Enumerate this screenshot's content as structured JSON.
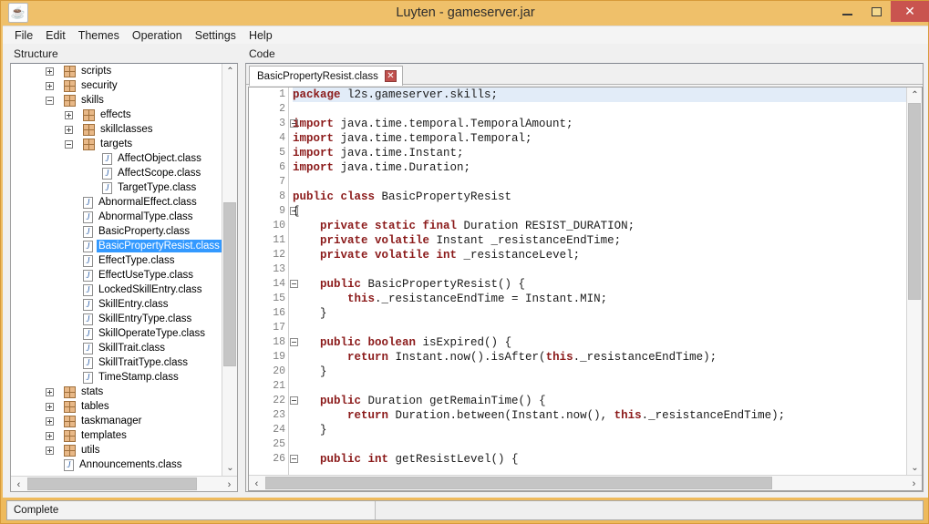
{
  "window": {
    "title": "Luyten - gameserver.jar",
    "app_icon": "coffee-cup-icon",
    "minimize_label": "–",
    "maximize_label": "☐",
    "close_label": "✕",
    "close_color": "#c9544f",
    "titlebar_color": "#efc06a"
  },
  "menubar": {
    "items": [
      {
        "label": "File"
      },
      {
        "label": "Edit"
      },
      {
        "label": "Themes"
      },
      {
        "label": "Operation"
      },
      {
        "label": "Settings"
      },
      {
        "label": "Help"
      }
    ]
  },
  "left_panel": {
    "label": "Structure",
    "tree": [
      {
        "label": "scripts",
        "indent": 1,
        "twisty": "plus",
        "icon": "package-icon",
        "selected": false
      },
      {
        "label": "security",
        "indent": 1,
        "twisty": "plus",
        "icon": "package-icon",
        "selected": false
      },
      {
        "label": "skills",
        "indent": 1,
        "twisty": "minus",
        "icon": "package-icon",
        "selected": false
      },
      {
        "label": "effects",
        "indent": 2,
        "twisty": "plus",
        "icon": "package-icon",
        "selected": false
      },
      {
        "label": "skillclasses",
        "indent": 2,
        "twisty": "plus",
        "icon": "package-icon",
        "selected": false
      },
      {
        "label": "targets",
        "indent": 2,
        "twisty": "minus",
        "icon": "package-icon",
        "selected": false
      },
      {
        "label": "AffectObject.class",
        "indent": 3,
        "twisty": "none",
        "icon": "java-class-icon",
        "selected": false
      },
      {
        "label": "AffectScope.class",
        "indent": 3,
        "twisty": "none",
        "icon": "java-class-icon",
        "selected": false
      },
      {
        "label": "TargetType.class",
        "indent": 3,
        "twisty": "none",
        "icon": "java-class-icon",
        "selected": false
      },
      {
        "label": "AbnormalEffect.class",
        "indent": 2,
        "twisty": "none",
        "icon": "java-class-icon",
        "selected": false
      },
      {
        "label": "AbnormalType.class",
        "indent": 2,
        "twisty": "none",
        "icon": "java-class-icon",
        "selected": false
      },
      {
        "label": "BasicProperty.class",
        "indent": 2,
        "twisty": "none",
        "icon": "java-class-icon",
        "selected": false
      },
      {
        "label": "BasicPropertyResist.class",
        "indent": 2,
        "twisty": "none",
        "icon": "java-class-icon",
        "selected": true
      },
      {
        "label": "EffectType.class",
        "indent": 2,
        "twisty": "none",
        "icon": "java-class-icon",
        "selected": false
      },
      {
        "label": "EffectUseType.class",
        "indent": 2,
        "twisty": "none",
        "icon": "java-class-icon",
        "selected": false
      },
      {
        "label": "LockedSkillEntry.class",
        "indent": 2,
        "twisty": "none",
        "icon": "java-class-icon",
        "selected": false
      },
      {
        "label": "SkillEntry.class",
        "indent": 2,
        "twisty": "none",
        "icon": "java-class-icon",
        "selected": false
      },
      {
        "label": "SkillEntryType.class",
        "indent": 2,
        "twisty": "none",
        "icon": "java-class-icon",
        "selected": false
      },
      {
        "label": "SkillOperateType.class",
        "indent": 2,
        "twisty": "none",
        "icon": "java-class-icon",
        "selected": false
      },
      {
        "label": "SkillTrait.class",
        "indent": 2,
        "twisty": "none",
        "icon": "java-class-icon",
        "selected": false
      },
      {
        "label": "SkillTraitType.class",
        "indent": 2,
        "twisty": "none",
        "icon": "java-class-icon",
        "selected": false
      },
      {
        "label": "TimeStamp.class",
        "indent": 2,
        "twisty": "none",
        "icon": "java-class-icon",
        "selected": false
      },
      {
        "label": "stats",
        "indent": 1,
        "twisty": "plus",
        "icon": "package-icon",
        "selected": false
      },
      {
        "label": "tables",
        "indent": 1,
        "twisty": "plus",
        "icon": "package-icon",
        "selected": false
      },
      {
        "label": "taskmanager",
        "indent": 1,
        "twisty": "plus",
        "icon": "package-icon",
        "selected": false
      },
      {
        "label": "templates",
        "indent": 1,
        "twisty": "plus",
        "icon": "package-icon",
        "selected": false
      },
      {
        "label": "utils",
        "indent": 1,
        "twisty": "plus",
        "icon": "package-icon",
        "selected": false
      },
      {
        "label": "Announcements.class",
        "indent": 1,
        "twisty": "none",
        "icon": "java-class-icon",
        "selected": false
      }
    ],
    "scroll_up_glyph": "⌃",
    "scroll_down_glyph": "⌄",
    "scroll_left_glyph": "‹",
    "scroll_right_glyph": "›"
  },
  "right_panel": {
    "label": "Code",
    "tab": {
      "title": "BasicPropertyResist.class",
      "close_glyph": "✕"
    },
    "scroll_up_glyph": "⌃",
    "scroll_down_glyph": "⌄",
    "scroll_left_glyph": "‹",
    "scroll_right_glyph": "›",
    "code_lines": [
      {
        "n": 1,
        "fold": false,
        "current": true,
        "parts": [
          {
            "t": "package",
            "c": "kw"
          },
          {
            "t": " l2s.gameserver.skills;",
            "c": "txt"
          }
        ]
      },
      {
        "n": 2,
        "fold": false,
        "current": false,
        "parts": [
          {
            "t": "",
            "c": "txt"
          }
        ]
      },
      {
        "n": 3,
        "fold": true,
        "current": false,
        "parts": [
          {
            "t": "import",
            "c": "kw"
          },
          {
            "t": " java.time.temporal.TemporalAmount;",
            "c": "txt"
          }
        ]
      },
      {
        "n": 4,
        "fold": false,
        "current": false,
        "parts": [
          {
            "t": "import",
            "c": "kw"
          },
          {
            "t": " java.time.temporal.Temporal;",
            "c": "txt"
          }
        ]
      },
      {
        "n": 5,
        "fold": false,
        "current": false,
        "parts": [
          {
            "t": "import",
            "c": "kw"
          },
          {
            "t": " java.time.Instant;",
            "c": "txt"
          }
        ]
      },
      {
        "n": 6,
        "fold": false,
        "current": false,
        "parts": [
          {
            "t": "import",
            "c": "kw"
          },
          {
            "t": " java.time.Duration;",
            "c": "txt"
          }
        ]
      },
      {
        "n": 7,
        "fold": false,
        "current": false,
        "parts": [
          {
            "t": "",
            "c": "txt"
          }
        ]
      },
      {
        "n": 8,
        "fold": false,
        "current": false,
        "parts": [
          {
            "t": "public class",
            "c": "kw"
          },
          {
            "t": " BasicPropertyResist",
            "c": "txt"
          }
        ]
      },
      {
        "n": 9,
        "fold": true,
        "current": false,
        "parts": [
          {
            "t": "{",
            "c": "txt"
          }
        ]
      },
      {
        "n": 10,
        "fold": false,
        "current": false,
        "parts": [
          {
            "t": "    ",
            "c": "txt"
          },
          {
            "t": "private static final",
            "c": "kw"
          },
          {
            "t": " Duration RESIST_DURATION;",
            "c": "txt"
          }
        ]
      },
      {
        "n": 11,
        "fold": false,
        "current": false,
        "parts": [
          {
            "t": "    ",
            "c": "txt"
          },
          {
            "t": "private volatile",
            "c": "kw"
          },
          {
            "t": " Instant _resistanceEndTime;",
            "c": "txt"
          }
        ]
      },
      {
        "n": 12,
        "fold": false,
        "current": false,
        "parts": [
          {
            "t": "    ",
            "c": "txt"
          },
          {
            "t": "private volatile int",
            "c": "kw"
          },
          {
            "t": " _resistanceLevel;",
            "c": "txt"
          }
        ]
      },
      {
        "n": 13,
        "fold": false,
        "current": false,
        "parts": [
          {
            "t": "",
            "c": "txt"
          }
        ]
      },
      {
        "n": 14,
        "fold": true,
        "current": false,
        "parts": [
          {
            "t": "    ",
            "c": "txt"
          },
          {
            "t": "public",
            "c": "kw"
          },
          {
            "t": " BasicPropertyResist() {",
            "c": "txt"
          }
        ]
      },
      {
        "n": 15,
        "fold": false,
        "current": false,
        "parts": [
          {
            "t": "        ",
            "c": "txt"
          },
          {
            "t": "this",
            "c": "kw"
          },
          {
            "t": "._resistanceEndTime = Instant.MIN;",
            "c": "txt"
          }
        ]
      },
      {
        "n": 16,
        "fold": false,
        "current": false,
        "parts": [
          {
            "t": "    }",
            "c": "txt"
          }
        ]
      },
      {
        "n": 17,
        "fold": false,
        "current": false,
        "parts": [
          {
            "t": "",
            "c": "txt"
          }
        ]
      },
      {
        "n": 18,
        "fold": true,
        "current": false,
        "parts": [
          {
            "t": "    ",
            "c": "txt"
          },
          {
            "t": "public boolean",
            "c": "kw"
          },
          {
            "t": " isExpired() {",
            "c": "txt"
          }
        ]
      },
      {
        "n": 19,
        "fold": false,
        "current": false,
        "parts": [
          {
            "t": "        ",
            "c": "txt"
          },
          {
            "t": "return",
            "c": "kw"
          },
          {
            "t": " Instant.now().isAfter(",
            "c": "txt"
          },
          {
            "t": "this",
            "c": "kw"
          },
          {
            "t": "._resistanceEndTime);",
            "c": "txt"
          }
        ]
      },
      {
        "n": 20,
        "fold": false,
        "current": false,
        "parts": [
          {
            "t": "    }",
            "c": "txt"
          }
        ]
      },
      {
        "n": 21,
        "fold": false,
        "current": false,
        "parts": [
          {
            "t": "",
            "c": "txt"
          }
        ]
      },
      {
        "n": 22,
        "fold": true,
        "current": false,
        "parts": [
          {
            "t": "    ",
            "c": "txt"
          },
          {
            "t": "public",
            "c": "kw"
          },
          {
            "t": " Duration getRemainTime() {",
            "c": "txt"
          }
        ]
      },
      {
        "n": 23,
        "fold": false,
        "current": false,
        "parts": [
          {
            "t": "        ",
            "c": "txt"
          },
          {
            "t": "return",
            "c": "kw"
          },
          {
            "t": " Duration.between(Instant.now(), ",
            "c": "txt"
          },
          {
            "t": "this",
            "c": "kw"
          },
          {
            "t": "._resistanceEndTime);",
            "c": "txt"
          }
        ]
      },
      {
        "n": 24,
        "fold": false,
        "current": false,
        "parts": [
          {
            "t": "    }",
            "c": "txt"
          }
        ]
      },
      {
        "n": 25,
        "fold": false,
        "current": false,
        "parts": [
          {
            "t": "",
            "c": "txt"
          }
        ]
      },
      {
        "n": 26,
        "fold": true,
        "current": false,
        "parts": [
          {
            "t": "    ",
            "c": "txt"
          },
          {
            "t": "public int",
            "c": "kw"
          },
          {
            "t": " getResistLevel() {",
            "c": "txt"
          }
        ]
      }
    ]
  },
  "statusbar": {
    "message": "Complete"
  }
}
